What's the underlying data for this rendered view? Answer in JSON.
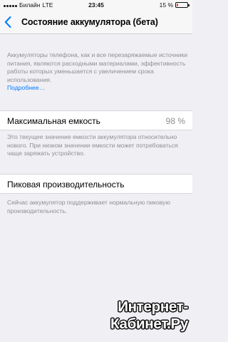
{
  "status_bar": {
    "carrier": "Билайн",
    "network": "LTE",
    "time": "23:45",
    "battery_percent": "15 %",
    "battery_level": 0.15
  },
  "nav": {
    "back_icon": "chevron-left-icon",
    "title": "Состояние аккумулятора (бета)"
  },
  "intro": {
    "text": "Аккумуляторы телефона, как и все перезаряжаемые источники питания, являются расходными материалами, эффективность работы которых уменьшается с увеличением срока использования.",
    "link": "Подробнее…"
  },
  "capacity": {
    "label": "Максимальная емкость",
    "value": "98 %",
    "footer": "Это текущее значение емкости аккумулятора относительно нового. При низком значении емкости может потребоваться чаще заряжать устройство."
  },
  "performance": {
    "label": "Пиковая производительность",
    "footer": "Сейчас аккумулятор поддерживает нормальную пиковую производительность."
  },
  "watermark": {
    "line1": "Интернет-",
    "line2": "Кабинет.Ру"
  },
  "colors": {
    "accent": "#007aff",
    "background": "#efeff4",
    "secondary_text": "#8e8e93",
    "battery_low": "#ff3b30"
  }
}
